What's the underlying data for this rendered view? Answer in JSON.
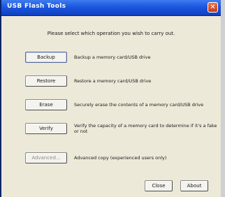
{
  "window": {
    "title": "USB Flash Tools"
  },
  "instruction": "Please select which operation you wish to carry out.",
  "operations": [
    {
      "label": "Backup",
      "description": "Backup a memory card/USB drive"
    },
    {
      "label": "Restore",
      "description": "Restore a memory card/USB drive"
    },
    {
      "label": "Erase",
      "description": "Securely erase the contents of a memory card/USB drive"
    },
    {
      "label": "Verify",
      "description": "Verify the capacity of a memory card to determine if it's a fake or not"
    },
    {
      "label": "Advanced...",
      "description": "Advanced copy (experienced users only)"
    }
  ],
  "footer": {
    "close_label": "Close",
    "about_label": "About"
  },
  "icons": {
    "close": "close-icon"
  }
}
